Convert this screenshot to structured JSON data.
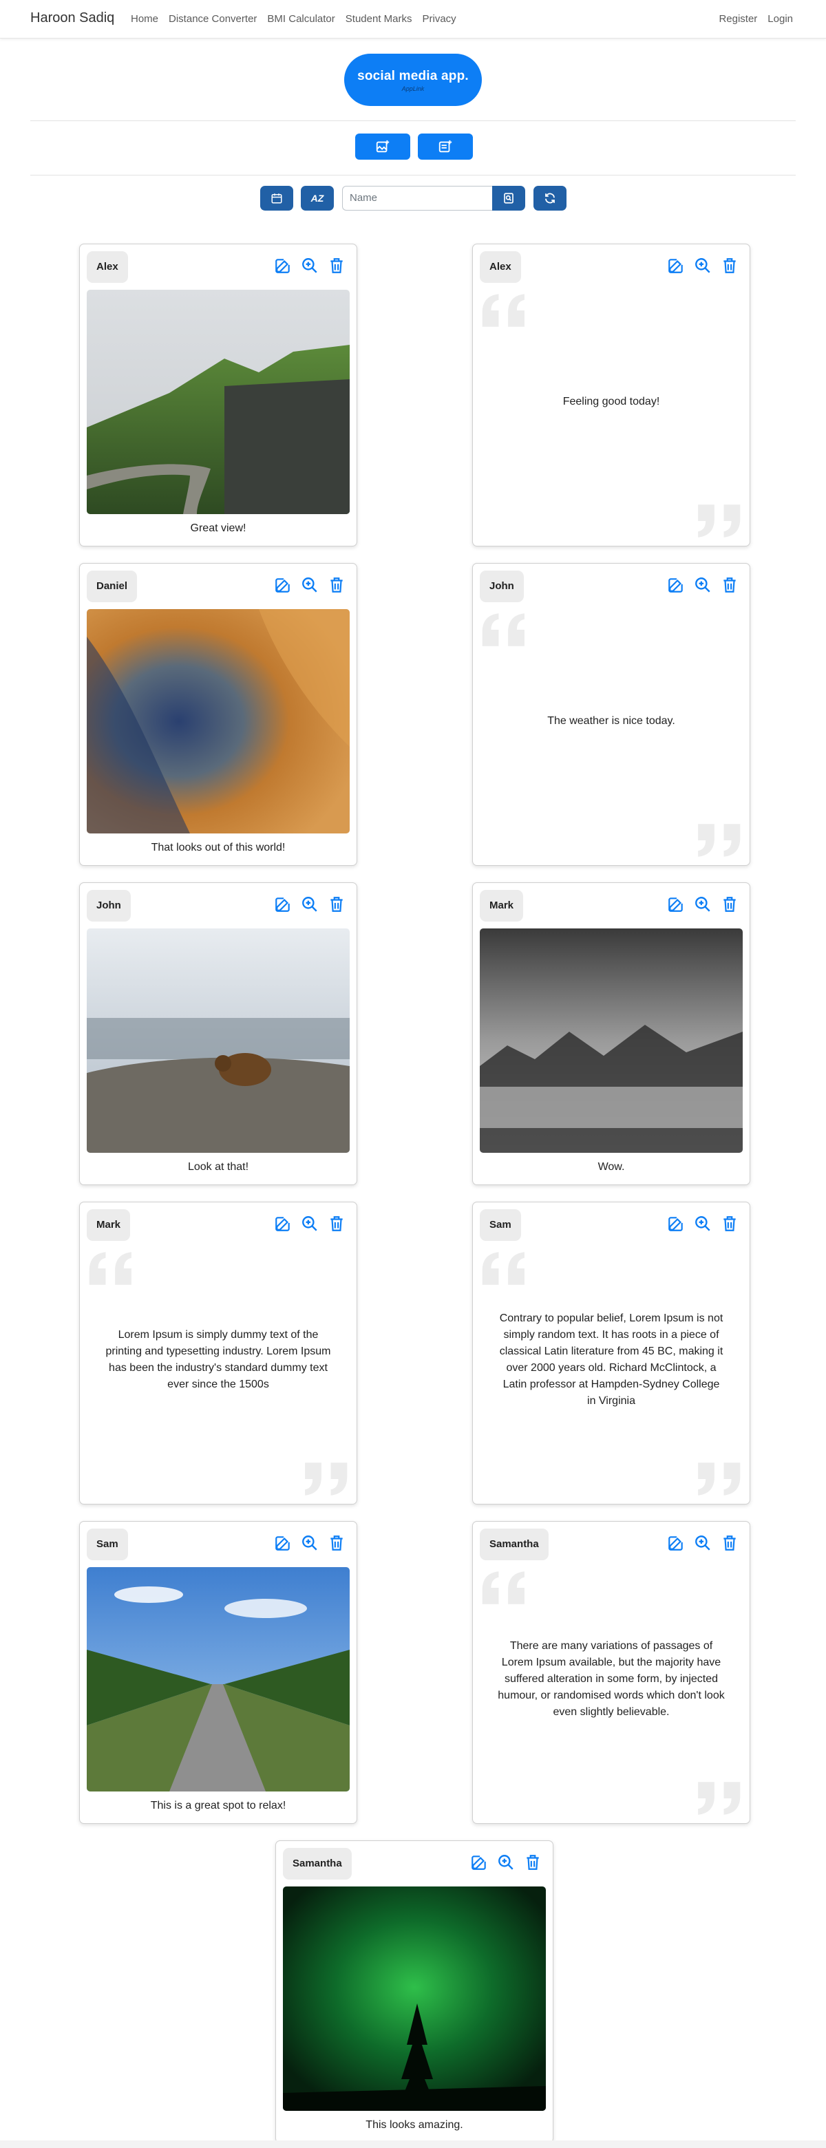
{
  "nav": {
    "brand": "Haroon Sadiq",
    "links": [
      "Home",
      "Distance Converter",
      "BMI Calculator",
      "Student Marks",
      "Privacy"
    ],
    "register": "Register",
    "login": "Login"
  },
  "logo": {
    "title": "social media app.",
    "subtitle": "AppLink"
  },
  "search": {
    "placeholder": "Name"
  },
  "sort_label": "AZ",
  "icons": {
    "add_image": "image-plus-icon",
    "add_post": "post-add-icon",
    "calendar": "calendar-icon",
    "sort": "sort-alpha-icon",
    "search": "search-icon",
    "refresh": "refresh-icon",
    "edit": "edit-icon",
    "zoom": "zoom-in-icon",
    "delete": "trash-icon"
  },
  "colors": {
    "primary": "#0d7ef5",
    "toolbar": "#2160a6",
    "icon_blue": "#0d7ef5"
  },
  "posts": [
    {
      "author": "Alex",
      "type": "image",
      "caption": "Great view!",
      "image": "green mountain valley with winding road"
    },
    {
      "author": "Alex",
      "type": "text",
      "text": "Feeling good today!"
    },
    {
      "author": "Daniel",
      "type": "image",
      "caption": "That looks out of this world!",
      "image": "orange crater surface"
    },
    {
      "author": "John",
      "type": "text",
      "text": "The weather is nice today."
    },
    {
      "author": "John",
      "type": "image",
      "caption": "Look at that!",
      "image": "brown bear on rocky ground"
    },
    {
      "author": "Mark",
      "type": "image",
      "caption": "Wow.",
      "image": "foggy black and white forest"
    },
    {
      "author": "Mark",
      "type": "text",
      "text": "Lorem Ipsum is simply dummy text of the printing and typesetting industry. Lorem Ipsum has been the industry's standard dummy text ever since the 1500s"
    },
    {
      "author": "Sam",
      "type": "text",
      "text": "Contrary to popular belief, Lorem Ipsum is not simply random text. It has roots in a piece of classical Latin literature from 45 BC, making it over 2000 years old. Richard McClintock, a Latin professor at Hampden-Sydney College in Virginia"
    },
    {
      "author": "Sam",
      "type": "image",
      "caption": "This is a great spot to relax!",
      "image": "tree lined road under blue sky"
    },
    {
      "author": "Samantha",
      "type": "text",
      "text": "There are many variations of passages of Lorem Ipsum available, but the majority have suffered alteration in some form, by injected humour, or randomised words which don't look even slightly believable."
    },
    {
      "author": "Samantha",
      "type": "image",
      "caption": "This looks amazing.",
      "image": "green aurora over pine tree"
    }
  ]
}
